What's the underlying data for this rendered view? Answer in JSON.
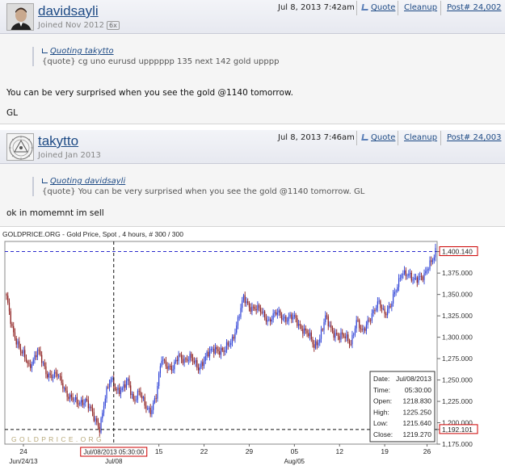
{
  "posts": [
    {
      "username": "davidsayli",
      "joined": "Joined Nov 2012",
      "badge": "6x",
      "date": "Jul 8, 2013 7:42am",
      "quote_label": "Quote",
      "cleanup_label": "Cleanup",
      "post_number": "Post# 24,002",
      "quoting": "Quoting takytto",
      "quote_text": "{quote} cg uno eurusd upppppp 135 next 142 gold upppp",
      "message_lines": [
        "You can be very surprised when you see the gold @1140 tomorrow.",
        "GL"
      ]
    },
    {
      "username": "takytto",
      "joined": "Joined Jan 2013",
      "date": "Jul 8, 2013 7:46am",
      "quote_label": "Quote",
      "cleanup_label": "Cleanup",
      "post_number": "Post# 24,003",
      "quoting": "Quoting davidsayli",
      "quote_text": "{quote} You can be very surprised when you see the gold @1140 tomorrow. GL",
      "message_lines": [
        "ok in momemnt im sell"
      ]
    }
  ],
  "colors": {
    "link": "#1d4a85",
    "candle_up": "#2b3fd6",
    "candle_down": "#8b1a1a",
    "price_line": "#2b2bcc",
    "marker_box": "#cc0000"
  },
  "chart_data": {
    "type": "candlestick",
    "title": "GOLDPRICE.ORG - Gold Price, Spot , 4 hours, # 300 / 300",
    "watermark": "G O L D P R I C E . O R G",
    "y_ticks": [
      "1,400.140",
      "1,375.000",
      "1,350.000",
      "1,325.000",
      "1,300.000",
      "1,275.000",
      "1,250.000",
      "1,225.000",
      "1,200.000",
      "1,192.101",
      "1,175.000"
    ],
    "ylim": [
      1175,
      1412
    ],
    "current_price": "1,400.140",
    "current_price_value": 1400.14,
    "low_line_label": "1,192.101",
    "low_line_value": 1192.101,
    "x_ticks": [
      "24",
      "15",
      "22",
      "29",
      "05",
      "12",
      "19",
      "26"
    ],
    "x_sub_labels": [
      "Jun/24/13",
      "Jul/08",
      "Aug/05"
    ],
    "cursor_label": "Jul/08/2013 05:30:00",
    "cursor_index": 76,
    "x_tick_indices": [
      12,
      108,
      140,
      172,
      204,
      236,
      268,
      298
    ],
    "x_sub_indices": [
      12,
      76,
      204
    ],
    "n_bars": 305,
    "anchors": [
      [
        0,
        1345
      ],
      [
        4,
        1310
      ],
      [
        10,
        1285
      ],
      [
        16,
        1265
      ],
      [
        22,
        1285
      ],
      [
        28,
        1258
      ],
      [
        36,
        1255
      ],
      [
        44,
        1232
      ],
      [
        50,
        1222
      ],
      [
        56,
        1228
      ],
      [
        62,
        1205
      ],
      [
        66,
        1195
      ],
      [
        70,
        1230
      ],
      [
        74,
        1250
      ],
      [
        78,
        1240
      ],
      [
        82,
        1238
      ],
      [
        86,
        1248
      ],
      [
        90,
        1228
      ],
      [
        94,
        1235
      ],
      [
        98,
        1220
      ],
      [
        102,
        1215
      ],
      [
        106,
        1230
      ],
      [
        110,
        1275
      ],
      [
        114,
        1268
      ],
      [
        118,
        1262
      ],
      [
        122,
        1278
      ],
      [
        126,
        1275
      ],
      [
        130,
        1275
      ],
      [
        136,
        1265
      ],
      [
        142,
        1278
      ],
      [
        148,
        1288
      ],
      [
        154,
        1282
      ],
      [
        160,
        1298
      ],
      [
        164,
        1320
      ],
      [
        168,
        1345
      ],
      [
        172,
        1337
      ],
      [
        176,
        1334
      ],
      [
        180,
        1330
      ],
      [
        186,
        1320
      ],
      [
        192,
        1328
      ],
      [
        198,
        1322
      ],
      [
        204,
        1322
      ],
      [
        210,
        1310
      ],
      [
        214,
        1302
      ],
      [
        218,
        1290
      ],
      [
        222,
        1300
      ],
      [
        226,
        1322
      ],
      [
        230,
        1310
      ],
      [
        236,
        1300
      ],
      [
        240,
        1300
      ],
      [
        244,
        1295
      ],
      [
        248,
        1318
      ],
      [
        252,
        1305
      ],
      [
        256,
        1320
      ],
      [
        260,
        1328
      ],
      [
        264,
        1340
      ],
      [
        268,
        1330
      ],
      [
        272,
        1335
      ],
      [
        276,
        1355
      ],
      [
        280,
        1378
      ],
      [
        284,
        1372
      ],
      [
        288,
        1367
      ],
      [
        292,
        1372
      ],
      [
        296,
        1370
      ],
      [
        300,
        1385
      ],
      [
        304,
        1402
      ]
    ],
    "info_box": {
      "date_label": "Date:",
      "date": "Jul/08/2013",
      "time_label": "Time:",
      "time": "05:30:00",
      "open_label": "Open:",
      "open": "1218.830",
      "high_label": "High:",
      "high": "1225.250",
      "low_label": "Low:",
      "low": "1215.640",
      "close_label": "Close:",
      "close": "1219.270"
    }
  }
}
